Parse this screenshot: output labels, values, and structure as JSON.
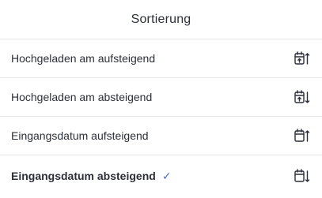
{
  "header": {
    "title": "Sortierung"
  },
  "options": [
    {
      "label": "Hochgeladen am aufsteigend",
      "icon": "calendar-upload-arrow-up-icon",
      "selected": false
    },
    {
      "label": "Hochgeladen am absteigend",
      "icon": "calendar-upload-arrow-down-icon",
      "selected": false
    },
    {
      "label": "Eingangsdatum aufsteigend",
      "icon": "calendar-arrow-up-icon",
      "selected": false
    },
    {
      "label": "Eingangsdatum absteigend",
      "icon": "calendar-arrow-down-icon",
      "selected": true
    }
  ],
  "check_mark": "✓",
  "colors": {
    "text": "#2b2f38",
    "accent": "#4a6fd6",
    "divider": "#e6e7ea"
  }
}
